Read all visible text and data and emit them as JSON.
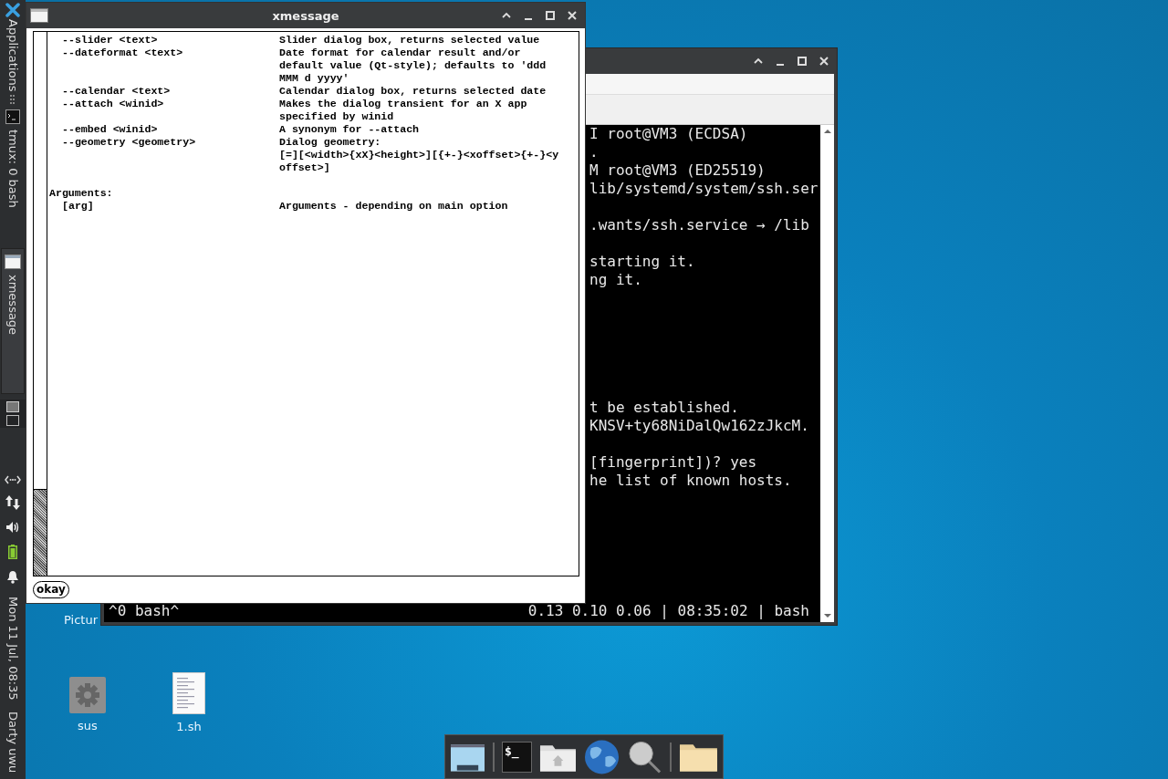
{
  "panel": {
    "launcher": "Applications",
    "tasks": [
      {
        "label": "tmux: 0 bash",
        "kind": "terminal",
        "selected": false
      },
      {
        "label": "xmessage",
        "kind": "window",
        "selected": true
      }
    ],
    "workspaces": [
      {
        "selected": true
      },
      {
        "selected": false
      }
    ],
    "clock": "Mon 11 Jul, 08:35",
    "user": "Darty uwu"
  },
  "desktop_icons": [
    {
      "label": "Pictur",
      "kind": "label-only"
    },
    {
      "label": "sus",
      "kind": "gear"
    },
    {
      "label": "1.sh",
      "kind": "document"
    }
  ],
  "terminal": {
    "blocks": [
      {
        "lines": [
          "I root@VM3 (ECDSA)",
          ".",
          "M root@VM3 (ED25519)",
          "lib/systemd/system/ssh.ser"
        ]
      },
      {
        "lines": [
          ".wants/ssh.service → /lib"
        ]
      },
      {
        "lines": [
          "starting it.",
          "ng it."
        ]
      },
      {
        "lines": [
          "t be established.",
          "KNSV+ty68NiDalQw162zJkcM."
        ]
      },
      {
        "lines": [
          "[fingerprint])? yes",
          "he list of known hosts."
        ]
      }
    ],
    "status_left": "^0 bash^",
    "status_right": "0.13 0.10 0.06 | 08:35:02 | bash"
  },
  "xmessage": {
    "title": "xmessage",
    "sections": [
      {
        "rows": [
          {
            "option": "--slider <text>",
            "description": "Slider dialog box, returns selected value"
          },
          {
            "option": "--dateformat <text>",
            "description": "Date format for calendar result and/or\ndefault value (Qt-style); defaults to 'ddd\nMMM d yyyy'"
          },
          {
            "option": "--calendar <text>",
            "description": "Calendar dialog box, returns selected date"
          },
          {
            "option": "--attach <winid>",
            "description": "Makes the dialog transient for an X app\nspecified by winid"
          },
          {
            "option": "--embed <winid>",
            "description": "A synonym for --attach"
          },
          {
            "option": "--geometry <geometry>",
            "description": "Dialog geometry:\n[=][<width>{xX}<height>][{+-}<xoffset>{+-}<y\noffset>]"
          }
        ]
      },
      {
        "heading": "Arguments:",
        "rows": [
          {
            "option": "[arg]",
            "description": "Arguments - depending on main option"
          }
        ]
      }
    ],
    "button": "okay"
  },
  "dock": {
    "items": [
      {
        "kind": "desktop"
      },
      {
        "kind": "separator"
      },
      {
        "kind": "terminal",
        "glyph": "$_"
      },
      {
        "kind": "home"
      },
      {
        "kind": "globe"
      },
      {
        "kind": "search"
      },
      {
        "kind": "separator"
      },
      {
        "kind": "folder"
      }
    ]
  }
}
